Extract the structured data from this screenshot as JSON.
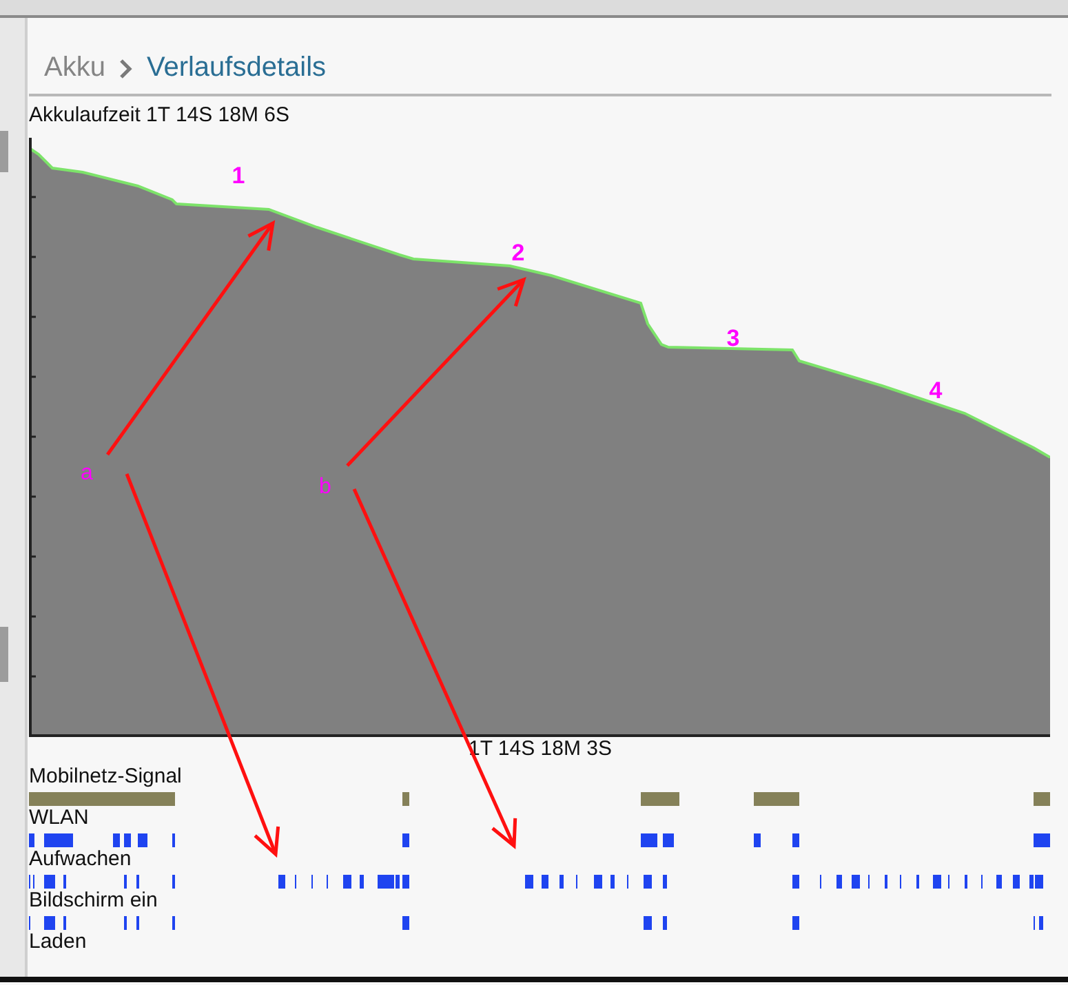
{
  "breadcrumb": {
    "parent": "Akku",
    "current": "Verlaufsdetails"
  },
  "chart": {
    "title": "Akkulaufzeit 1T 14S 18M 6S",
    "axis_label": "1T 14S 18M 3S",
    "annotations": [
      "1",
      "2",
      "3",
      "4",
      "a",
      "b"
    ]
  },
  "tracks": [
    {
      "label": "Mobilnetz-Signal",
      "kind": "signal"
    },
    {
      "label": "WLAN",
      "kind": "events"
    },
    {
      "label": "Aufwachen",
      "kind": "events"
    },
    {
      "label": "Bildschirm ein",
      "kind": "events"
    },
    {
      "label": "Laden",
      "kind": "empty"
    }
  ]
}
